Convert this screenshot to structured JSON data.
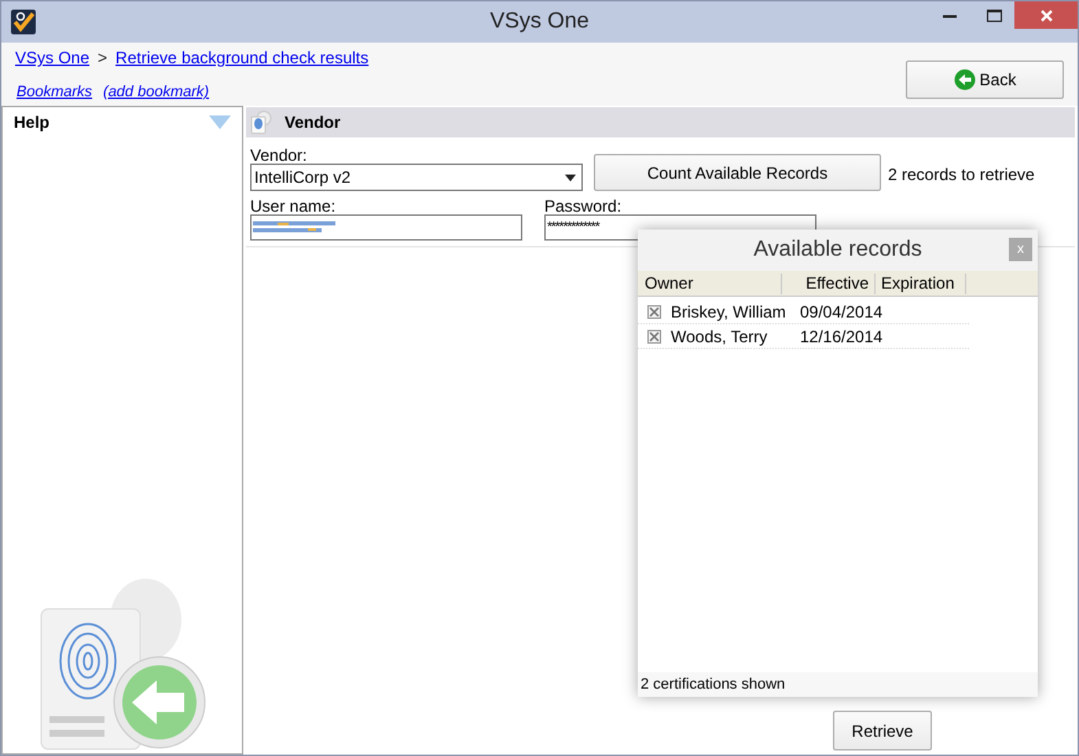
{
  "window": {
    "title": "VSys One"
  },
  "breadcrumb": [
    {
      "label": "VSys One"
    },
    {
      "label": ">",
      "kind": "separator"
    },
    {
      "label": "Retrieve background check results"
    }
  ],
  "bookmarks": [
    {
      "label": "Bookmarks"
    },
    {
      "label": "(add bookmark)"
    }
  ],
  "back_button": {
    "label": "Back"
  },
  "help": {
    "title": "Help"
  },
  "vendor_section": {
    "title": "Vendor",
    "vendor_label": "Vendor:",
    "vendor_value": "IntelliCorp v2",
    "count_button": "Count Available Records",
    "count_text": "2 records to retrieve",
    "username_label": "User name:",
    "password_label": "Password:",
    "password_value": "*************"
  },
  "popup": {
    "title": "Available records",
    "close": "x",
    "columns": [
      "Owner",
      "Effective",
      "Expiration"
    ],
    "rows": [
      {
        "owner": "Briskey, William",
        "effective": "09/04/2014",
        "checked": true
      },
      {
        "owner": "Woods, Terry",
        "effective": "12/16/2014",
        "checked": true
      }
    ],
    "footer": "2 certifications shown"
  },
  "retrieve_button": {
    "label": "Retrieve"
  }
}
